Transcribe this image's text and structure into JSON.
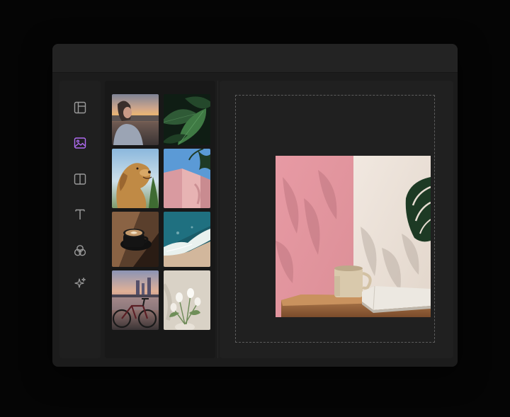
{
  "app": {
    "accent": "#b06cf2",
    "icon_color": "#9a9a9a"
  },
  "toolbar": {
    "tools": [
      {
        "id": "layout",
        "icon": "layout-icon",
        "active": false
      },
      {
        "id": "images",
        "icon": "image-icon",
        "active": true
      },
      {
        "id": "split",
        "icon": "split-view-icon",
        "active": false
      },
      {
        "id": "text",
        "icon": "text-icon",
        "active": false
      },
      {
        "id": "elements",
        "icon": "shapes-icon",
        "active": false
      },
      {
        "id": "magic",
        "icon": "sparkles-icon",
        "active": false
      }
    ]
  },
  "gallery": {
    "images": [
      {
        "subject": "woman-at-sunset"
      },
      {
        "subject": "green-leaves"
      },
      {
        "subject": "golden-retriever"
      },
      {
        "subject": "pink-wall-palm"
      },
      {
        "subject": "latte-cup"
      },
      {
        "subject": "ocean-wave-beach"
      },
      {
        "subject": "city-bicycle"
      },
      {
        "subject": "white-tulips"
      }
    ]
  },
  "canvas": {
    "image_subject": "coffee-cup-pink-wall-monstera",
    "selected_image": "coffee-cup-pink-wall-monstera"
  }
}
